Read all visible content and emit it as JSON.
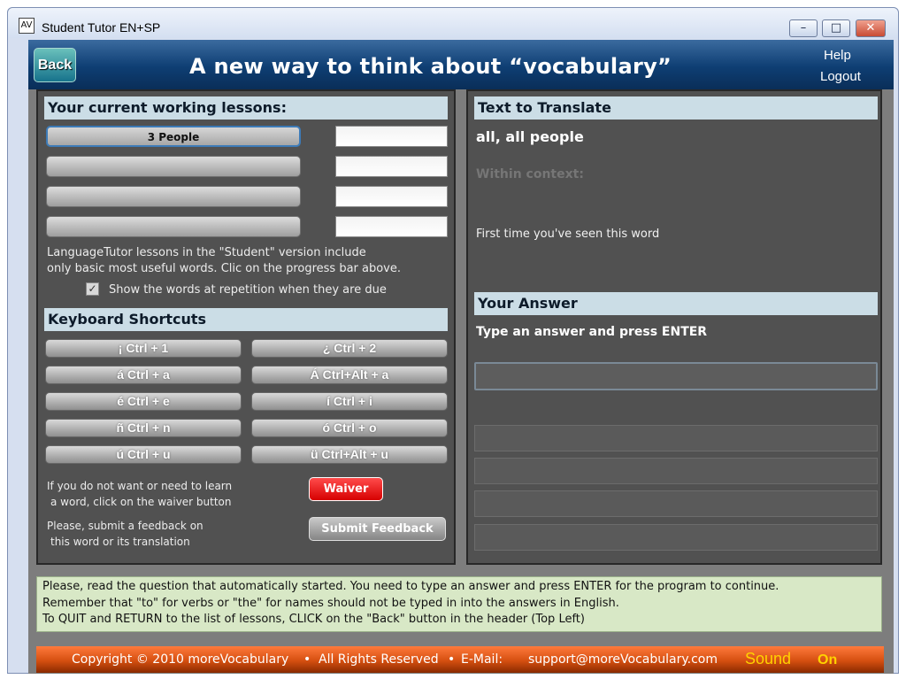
{
  "window": {
    "title": "Student Tutor EN+SP",
    "app_icon_label": "AV"
  },
  "header": {
    "back_label": "Back",
    "title": "A new way to think about “vocabulary”",
    "help_label": "Help",
    "logout_label": "Logout"
  },
  "lessons": {
    "heading": "Your current working lessons:",
    "items": [
      {
        "label": "3 People",
        "value": ""
      },
      {
        "label": "",
        "value": ""
      },
      {
        "label": "",
        "value": ""
      },
      {
        "label": "",
        "value": ""
      }
    ],
    "info_line1": "LanguageTutor lessons in the \"Student\" version include",
    "info_line2": "only basic most useful words. Clic on the progress bar above.",
    "checkbox_label": "Show the words at repetition when they are due",
    "checkbox_checked": true
  },
  "shortcuts": {
    "heading": "Keyboard Shortcuts",
    "buttons": [
      "¡  Ctrl + 1",
      "¿  Ctrl + 2",
      "á  Ctrl + a",
      "Á  Ctrl+Alt + a",
      "é  Ctrl + e",
      "í  Ctrl + i",
      "ñ  Ctrl + n",
      "ó  Ctrl + o",
      "ú  Ctrl + u",
      "ü  Ctrl+Alt + u"
    ]
  },
  "waiver": {
    "text_line1": "If you do not want or need to learn",
    "text_line2": "a word, click on the waiver button",
    "button_label": "Waiver"
  },
  "feedback": {
    "text_line1": "Please, submit a feedback on",
    "text_line2": "this word or its translation",
    "button_label": "Submit Feedback"
  },
  "translate": {
    "heading": "Text to Translate",
    "word": "all, all people",
    "context_label": "Within context:",
    "first_time_text": "First time you've seen this word"
  },
  "answer": {
    "heading": "Your Answer",
    "prompt": "Type an answer and press ENTER",
    "input_value": ""
  },
  "message": {
    "line1": "Please, read the question that automatically started. You need to type an answer and press ENTER for the program to continue.",
    "line2": "Remember that \"to\" for verbs or \"the\" for names should not be typed in into the answers in English.",
    "line3": "To QUIT and RETURN to the list of lessons, CLICK on the \"Back\" button in the header (Top Left)"
  },
  "footer": {
    "copyright": "Copyright © 2010 moreVocabulary",
    "rights": "All Rights Reserved",
    "email_label": "E-Mail:",
    "email": "support@moreVocabulary.com",
    "sound_label": "Sound",
    "sound_state": "On"
  },
  "colors": {
    "header_blue": "#0e3e73",
    "panel_bg": "#515151",
    "section_head_bg": "#cbdde6",
    "waiver_red": "#e00000",
    "footer_orange": "#d54f10",
    "sound_yellow": "#ffd200",
    "message_bg": "#d8e8c6"
  }
}
